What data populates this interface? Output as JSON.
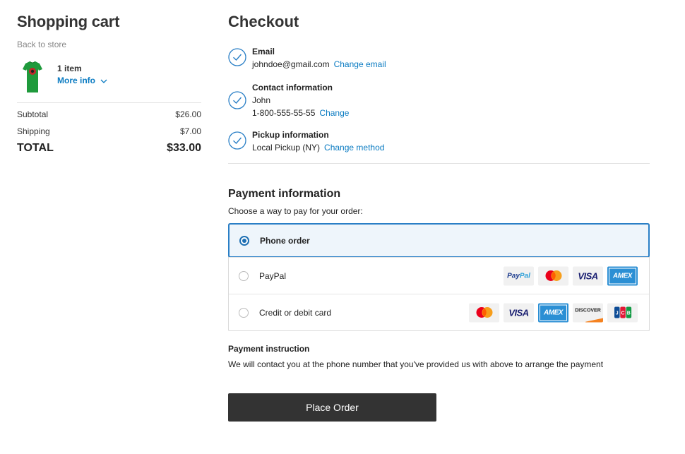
{
  "cart": {
    "title": "Shopping cart",
    "back_link": "Back to store",
    "item_count": "1 item",
    "more_info": "More info",
    "subtotal_label": "Subtotal",
    "subtotal_value": "$26.00",
    "shipping_label": "Shipping",
    "shipping_value": "$7.00",
    "total_label": "TOTAL",
    "total_value": "$33.00"
  },
  "checkout": {
    "title": "Checkout",
    "email": {
      "label": "Email",
      "value": "johndoe@gmail.com",
      "link": "Change email"
    },
    "contact": {
      "label": "Contact information",
      "name": "John",
      "phone": "1-800-555-55-55",
      "link": "Change"
    },
    "pickup": {
      "label": "Pickup information",
      "value": "Local Pickup (NY)",
      "link": "Change method"
    }
  },
  "payment": {
    "title": "Payment information",
    "subtitle": "Choose a way to pay for your order:",
    "options": [
      {
        "label": "Phone order",
        "selected": true,
        "logos": []
      },
      {
        "label": "PayPal",
        "selected": false,
        "logos": [
          "paypal-logo",
          "mastercard-logo",
          "visa-logo",
          "amex-logo"
        ]
      },
      {
        "label": "Credit or debit card",
        "selected": false,
        "logos": [
          "mastercard-logo",
          "visa-logo",
          "amex-logo",
          "discover-logo",
          "jcb-logo"
        ]
      }
    ],
    "logo_text": {
      "paypal_a": "Pay",
      "paypal_b": "Pal",
      "visa": "VISA",
      "amex": "AMEX",
      "discover": "DISCOVER"
    },
    "instruction_title": "Payment instruction",
    "instruction_text": "We will contact you at the phone number that you've provided us with above to arrange the payment"
  },
  "actions": {
    "place_order": "Place Order"
  },
  "colors": {
    "accent": "#0a7bc2",
    "selected_border": "#2a7fc6",
    "selected_bg": "#eef5fb",
    "button_bg": "#333333"
  }
}
